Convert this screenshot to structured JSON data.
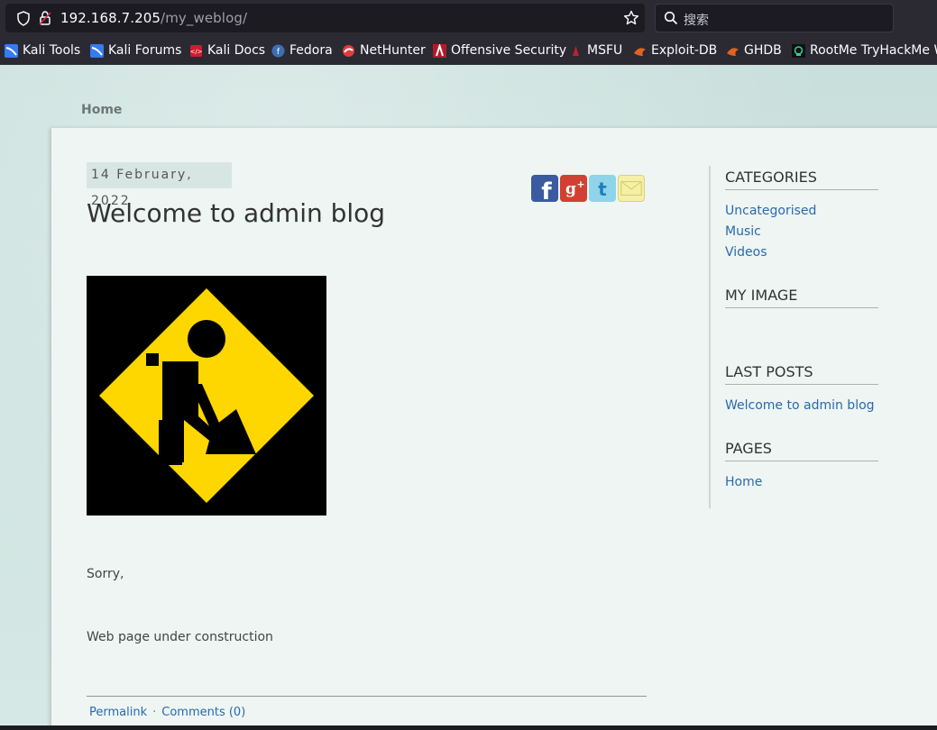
{
  "browser": {
    "url_host": "192.168.7.205",
    "url_path": "/my_weblog/",
    "search_placeholder": "搜索"
  },
  "bookmarks": [
    {
      "label": "Kali Tools",
      "icon": "kali-icon"
    },
    {
      "label": "Kali Forums",
      "icon": "kali-icon"
    },
    {
      "label": "Kali Docs",
      "icon": "kali-docs-icon"
    },
    {
      "label": "Fedora",
      "icon": "fedora-icon"
    },
    {
      "label": "NetHunter",
      "icon": "nethunter-icon"
    },
    {
      "label": "Offensive Security",
      "icon": "offsec-icon"
    },
    {
      "label": "MSFU",
      "icon": "msfu-icon"
    },
    {
      "label": "Exploit-DB",
      "icon": "exploitdb-icon"
    },
    {
      "label": "GHDB",
      "icon": "ghdb-icon"
    },
    {
      "label": "RootMe TryHackMe W",
      "icon": "rootme-icon"
    }
  ],
  "nav": {
    "home": "Home"
  },
  "post": {
    "date": "14 February, 2022",
    "title": "Welcome to admin blog",
    "paragraphs": [
      "Sorry,",
      "Web page under construction"
    ],
    "permalink": "Permalink",
    "separator": "·",
    "comments": "Comments (0)"
  },
  "sidebar": {
    "categories_title": "CATEGORIES",
    "categories": [
      "Uncategorised",
      "Music",
      "Videos"
    ],
    "my_image_title": "MY IMAGE",
    "last_posts_title": "LAST POSTS",
    "last_posts": [
      "Welcome to admin blog"
    ],
    "pages_title": "PAGES",
    "pages": [
      "Home"
    ]
  },
  "colors": {
    "accent_link": "#2a6aad",
    "sign_yellow": "#ffd700",
    "chrome_bg": "#2b2a33"
  }
}
